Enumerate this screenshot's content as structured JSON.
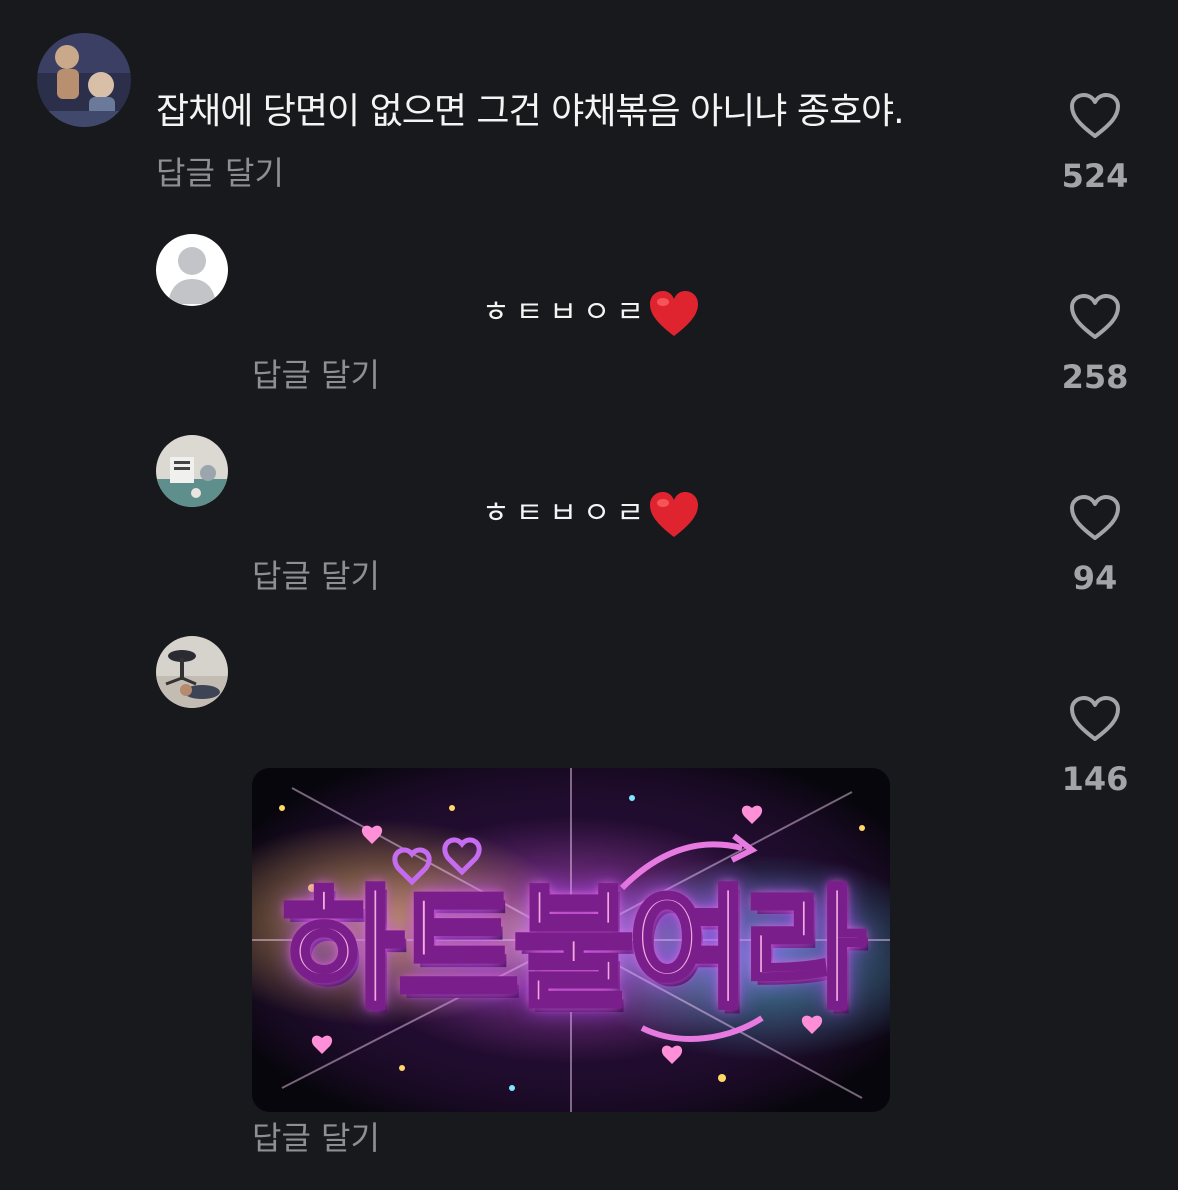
{
  "comments": [
    {
      "text": "잡채에 당면이 없으면 그건 야채볶음 아니냐 종호야.",
      "reply_label": "답글 달기",
      "like_count": "524"
    },
    {
      "text": "ㅎㅌㅂㅇㄹ",
      "reply_label": "답글 달기",
      "like_count": "258"
    },
    {
      "text": "ㅎㅌㅂㅇㄹ",
      "reply_label": "답글 달기",
      "like_count": "94"
    },
    {
      "sticker_text": "하트불여라",
      "reply_label": "답글 달기",
      "like_count": "146"
    }
  ],
  "icons": {
    "like": "heart-outline-icon",
    "emoji": "red-heart-emoji"
  },
  "colors": {
    "background": "#18191c",
    "text": "#f4f4f4",
    "muted": "#8e8f93",
    "heart_emoji": "#e0242f"
  }
}
